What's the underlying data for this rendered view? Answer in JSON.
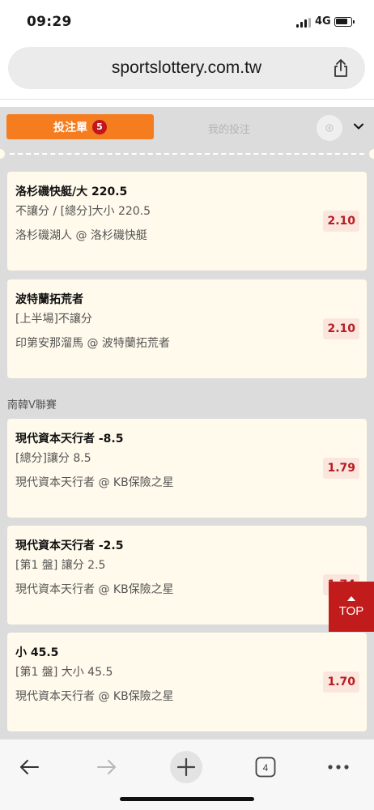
{
  "status": {
    "time": "09:29",
    "network": "4G"
  },
  "browser": {
    "url": "sportslottery.com.tw",
    "tab_count": "4"
  },
  "tabs": {
    "bet_slip_label": "投注單",
    "bet_slip_count": "5",
    "my_bets_label": "我的投注"
  },
  "bets_group1": [
    {
      "title": "洛杉磯快艇/大 220.5",
      "market": "不讓分 / [總分]大小 220.5",
      "match": "洛杉磯湖人 @ 洛杉磯快艇",
      "odds": "2.10"
    },
    {
      "title": "波特蘭拓荒者",
      "market": "[上半場]不讓分",
      "match": "印第安那溜馬 @ 波特蘭拓荒者",
      "odds": "2.10"
    }
  ],
  "league": "南韓V聯賽",
  "bets_group2": [
    {
      "title": "現代資本天行者 -8.5",
      "market": "[總分]讓分 8.5",
      "match": "現代資本天行者 @ KB保險之星",
      "odds": "1.79"
    },
    {
      "title": "現代資本天行者 -2.5",
      "market": "[第1 盤] 讓分 2.5",
      "match": "現代資本天行者 @ KB保險之星",
      "odds": "1.74"
    },
    {
      "title": "小 45.5",
      "market": "[第1 盤] 大小 45.5",
      "match": "現代資本天行者 @ KB保險之星",
      "odds": "1.70"
    }
  ],
  "top_button": "TOP",
  "colors": {
    "accent_orange": "#f57c1f",
    "odds_red": "#b61d22",
    "top_red": "#c21b1b",
    "card_bg": "#fffaec"
  }
}
